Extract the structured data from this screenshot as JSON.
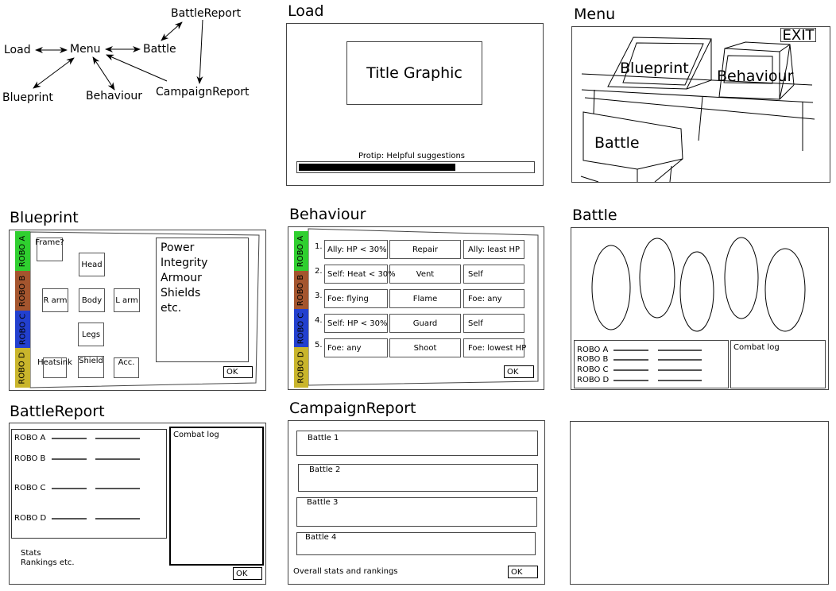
{
  "nav_diagram": {
    "nodes": [
      "Load",
      "Menu",
      "Battle",
      "BattleReport",
      "Blueprint",
      "Behaviour",
      "CampaignReport"
    ]
  },
  "load": {
    "title": "Load",
    "graphic": "Title Graphic",
    "protip": "Protip: Helpful suggestions",
    "progress": 0.67
  },
  "menu": {
    "title": "Menu",
    "exit": "EXIT",
    "blueprint": "Blueprint",
    "behaviour": "Behaviour",
    "battle": "Battle"
  },
  "robots": [
    "ROBO A",
    "ROBO B",
    "ROBO C",
    "ROBO D"
  ],
  "robot_colors": [
    "#2fcf2f",
    "#a4552e",
    "#2340cf",
    "#c9b52c"
  ],
  "blueprint": {
    "title": "Blueprint",
    "parts": {
      "frame": "Frame?",
      "head": "Head",
      "rarm": "R arm",
      "body": "Body",
      "larm": "L arm",
      "legs": "Legs",
      "heatsink": "Heatsink",
      "shield": "Shield",
      "acc": "Acc."
    },
    "stats": [
      "Power",
      "Integrity",
      "Armour",
      "Shields",
      "etc."
    ],
    "ok": "OK"
  },
  "behaviour": {
    "title": "Behaviour",
    "rules": [
      {
        "n": "1.",
        "cond": "Ally: HP < 30%",
        "action": "Repair",
        "target": "Ally: least HP"
      },
      {
        "n": "2.",
        "cond": "Self: Heat < 30%",
        "action": "Vent",
        "target": "Self"
      },
      {
        "n": "3.",
        "cond": "Foe: flying",
        "action": "Flame",
        "target": "Foe: any"
      },
      {
        "n": "4.",
        "cond": "Self: HP < 30%",
        "action": "Guard",
        "target": "Self"
      },
      {
        "n": "5.",
        "cond": "Foe: any",
        "action": "Shoot",
        "target": "Foe: lowest HP"
      }
    ],
    "ok": "OK"
  },
  "battle": {
    "title": "Battle",
    "combat_log": "Combat log"
  },
  "battle_report": {
    "title": "BattleReport",
    "combat_log": "Combat log",
    "stats": "Stats",
    "rankings": "Rankings etc.",
    "ok": "OK"
  },
  "campaign_report": {
    "title": "CampaignReport",
    "battles": [
      "Battle 1",
      "Battle 2",
      "Battle 3",
      "Battle 4"
    ],
    "overall": "Overall stats and rankings",
    "ok": "OK"
  }
}
